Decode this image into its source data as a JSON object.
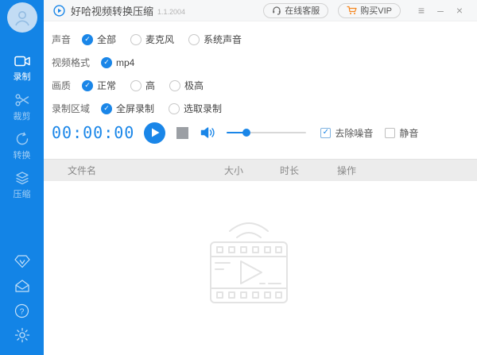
{
  "app": {
    "title": "好哈视频转换压缩",
    "version": "1.1.2004"
  },
  "colors": {
    "sidebar_blue": "#1384e6",
    "accent_blue": "#1a86e8",
    "vip_orange": "#f5861f",
    "table_header_bg": "#ececec"
  },
  "topbar": {
    "support_label": "在线客服",
    "buy_vip_label": "购买VIP",
    "menu_glyph": "≡",
    "minimize_glyph": "–",
    "close_glyph": "×"
  },
  "sidebar": {
    "items": [
      {
        "label": "录制",
        "icon": "record-camera-icon",
        "active": true
      },
      {
        "label": "裁剪",
        "icon": "scissors-icon",
        "active": false
      },
      {
        "label": "转换",
        "icon": "convert-icon",
        "active": false
      },
      {
        "label": "压缩",
        "icon": "compress-icon",
        "active": false
      }
    ],
    "bottom_icons": [
      "vip-diamond-icon",
      "mail-icon",
      "help-icon",
      "settings-icon"
    ]
  },
  "settings": {
    "rows": [
      {
        "label": "声音",
        "options": [
          {
            "label": "全部",
            "checked": true
          },
          {
            "label": "麦克风",
            "checked": false
          },
          {
            "label": "系统声音",
            "checked": false
          }
        ]
      },
      {
        "label": "视频格式",
        "options": [
          {
            "label": "mp4",
            "checked": true
          }
        ]
      },
      {
        "label": "画质",
        "options": [
          {
            "label": "正常",
            "checked": true
          },
          {
            "label": "高",
            "checked": false
          },
          {
            "label": "极高",
            "checked": false
          }
        ]
      },
      {
        "label": "录制区域",
        "options": [
          {
            "label": "全屏录制",
            "checked": true
          },
          {
            "label": "选取录制",
            "checked": false
          }
        ]
      }
    ]
  },
  "controls": {
    "timer": "00:00:00",
    "volume_percent": 25,
    "checkboxes": [
      {
        "label": "去除噪音",
        "checked": true
      },
      {
        "label": "静音",
        "checked": false
      }
    ]
  },
  "table": {
    "columns": [
      "文件名",
      "大小",
      "时长",
      "操作"
    ]
  }
}
